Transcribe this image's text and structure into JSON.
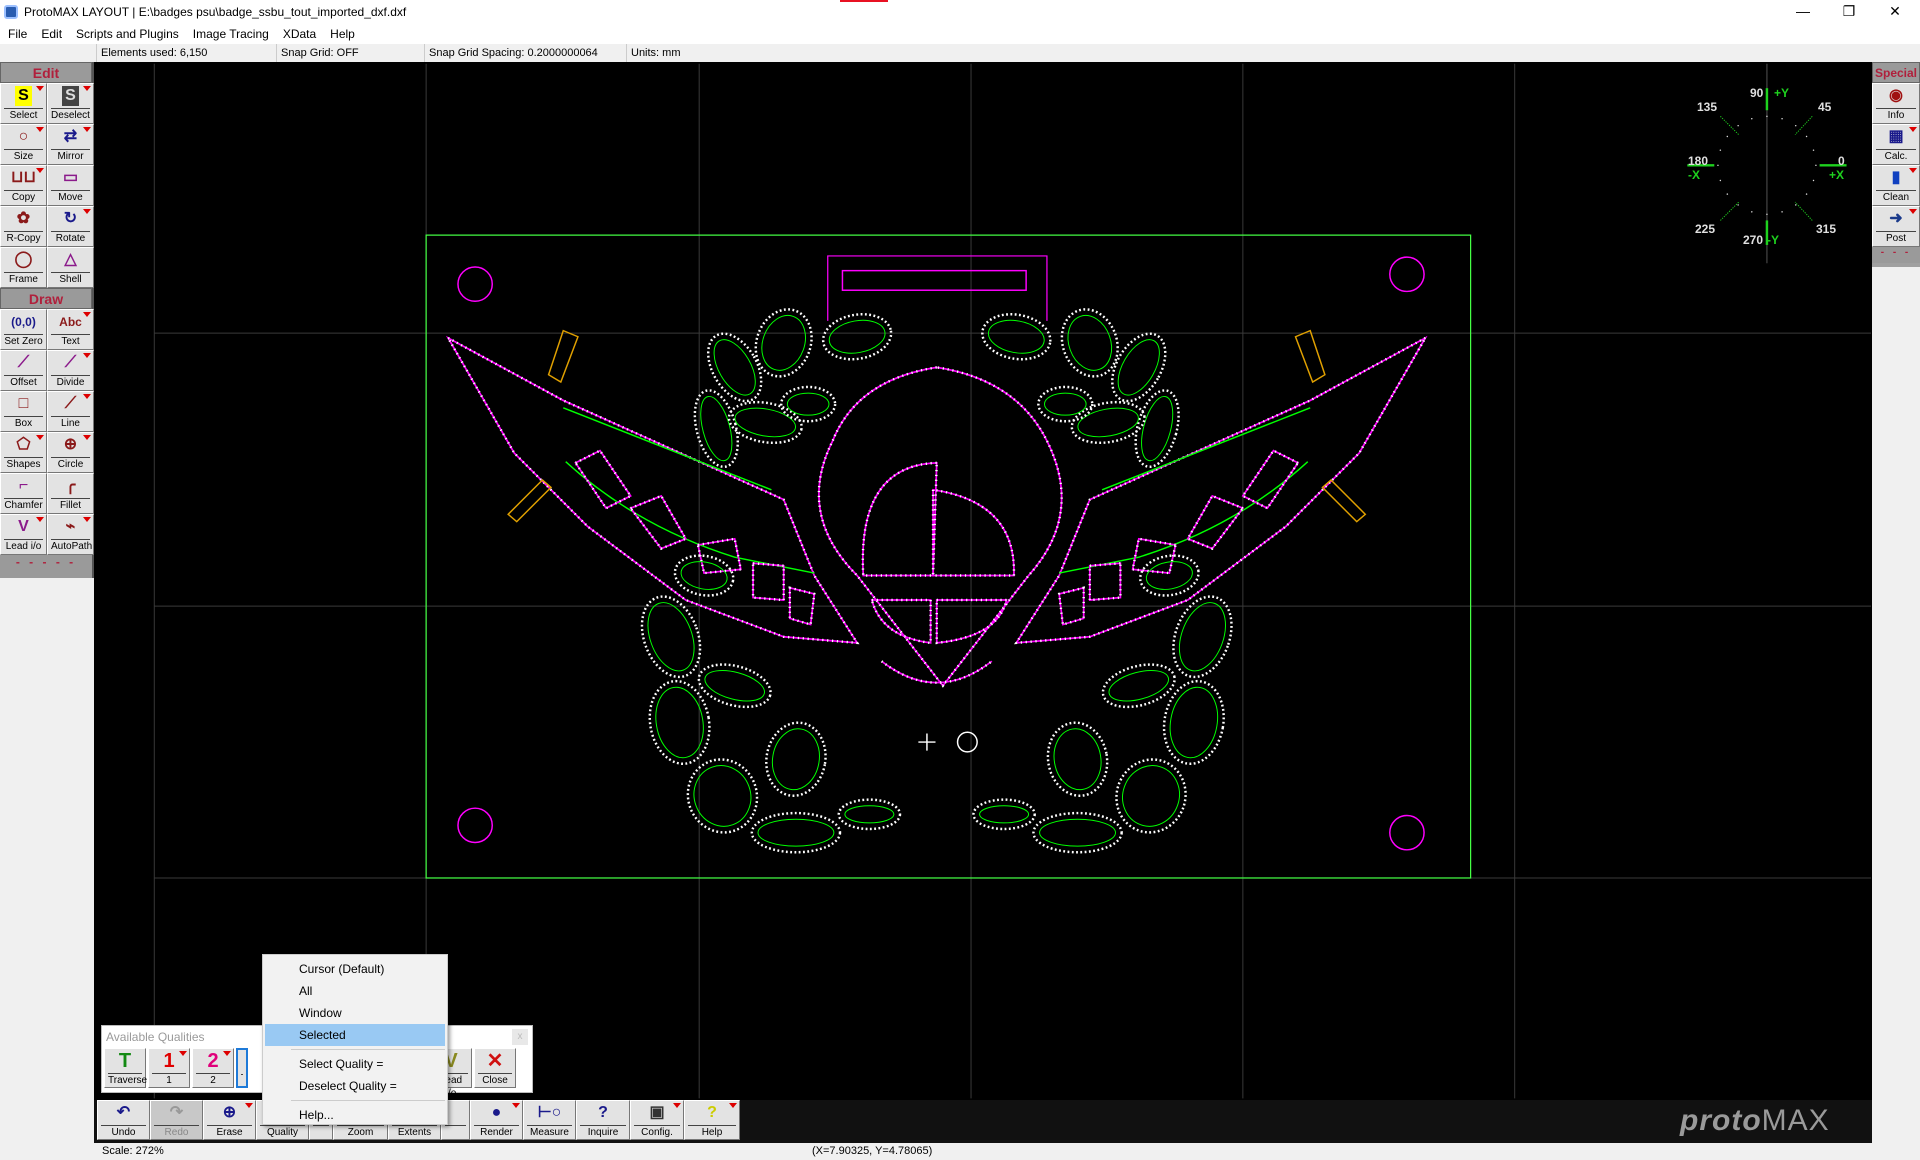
{
  "window": {
    "title": "ProtoMAX LAYOUT | E:\\badges psu\\badge_ssbu_tout_imported_dxf.dxf",
    "minimize": "—",
    "restore": "❐",
    "close": "✕"
  },
  "menu": [
    "File",
    "Edit",
    "Scripts and Plugins",
    "Image Tracing",
    "XData",
    "Help"
  ],
  "info": {
    "elements": "Elements used: 6,150",
    "snap": "Snap Grid: OFF",
    "spacing": "Snap Grid Spacing: 0.2000000064",
    "units": "Units: mm"
  },
  "left_toolbar": {
    "edit_header": "Edit",
    "draw_header": "Draw",
    "footer": "- - - - -",
    "edit": [
      {
        "label": "Select",
        "icon": "select-icon"
      },
      {
        "label": "Deselect",
        "icon": "deselect-icon"
      },
      {
        "label": "Size",
        "icon": "size-icon"
      },
      {
        "label": "Mirror",
        "icon": "mirror-icon"
      },
      {
        "label": "Copy",
        "icon": "copy-icon"
      },
      {
        "label": "Move",
        "icon": "move-icon"
      },
      {
        "label": "R-Copy",
        "icon": "rotary-copy-icon"
      },
      {
        "label": "Rotate",
        "icon": "rotate-icon"
      },
      {
        "label": "Frame",
        "icon": "frame-icon"
      },
      {
        "label": "Shell",
        "icon": "shell-icon"
      }
    ],
    "draw": [
      {
        "label": "Set Zero",
        "icon": "set-zero-icon",
        "glyph": "(0,0)"
      },
      {
        "label": "Text",
        "icon": "text-icon",
        "glyph": "Abc"
      },
      {
        "label": "Offset",
        "icon": "offset-icon"
      },
      {
        "label": "Divide",
        "icon": "divide-icon"
      },
      {
        "label": "Box",
        "icon": "box-icon"
      },
      {
        "label": "Line",
        "icon": "line-icon"
      },
      {
        "label": "Shapes",
        "icon": "shapes-icon"
      },
      {
        "label": "Circle",
        "icon": "circle-icon"
      },
      {
        "label": "Chamfer",
        "icon": "chamfer-icon"
      },
      {
        "label": "Fillet",
        "icon": "fillet-icon"
      },
      {
        "label": "Lead i/o",
        "icon": "lead-io-icon"
      },
      {
        "label": "AutoPath",
        "icon": "autopath-icon"
      }
    ]
  },
  "right_toolbar": {
    "header": "Special",
    "footer": "- - -",
    "items": [
      {
        "label": "Info",
        "icon": "info-icon"
      },
      {
        "label": "Calc.",
        "icon": "calculator-icon"
      },
      {
        "label": "Clean",
        "icon": "clean-icon"
      },
      {
        "label": "Post",
        "icon": "post-arrow-icon"
      }
    ]
  },
  "compass": {
    "a0": "0",
    "a45": "45",
    "a90": "90",
    "a135": "135",
    "a180": "180",
    "a225": "225",
    "a270": "270",
    "a315": "315",
    "px": "+X",
    "nx": "-X",
    "py": "+Y",
    "ny": "-Y"
  },
  "colors": {
    "cut_outer": "#ff00ff",
    "cut_inner": "#00ff00",
    "border": "#44ff44",
    "lead": "#e0a000",
    "highlight": "#99c9f3"
  },
  "qualities": {
    "title": "Available Qualities",
    "close": "x",
    "buttons": [
      {
        "label": "Traverse",
        "glyph": "T"
      },
      {
        "label": "1",
        "glyph": "1"
      },
      {
        "label": "2",
        "glyph": "2"
      },
      {
        "label": "",
        "glyph": ""
      },
      {
        "label": "Lead i/o",
        "glyph": "V"
      },
      {
        "label": "Close",
        "glyph": "✕"
      }
    ]
  },
  "popup": {
    "items": [
      "Cursor (Default)",
      "All",
      "Window",
      "Selected",
      "Select Quality =",
      "Deselect Quality =",
      "Help..."
    ],
    "selected": "Selected"
  },
  "bottom_toolbar": [
    {
      "label": "Undo",
      "glyph": "↶"
    },
    {
      "label": "Redo",
      "glyph": "↷"
    },
    {
      "label": "Erase",
      "glyph": "⊕"
    },
    {
      "label": "Quality",
      "glyph": "◯"
    },
    {
      "label": "",
      "glyph": ""
    },
    {
      "label": "Zoom",
      "glyph": ""
    },
    {
      "label": "Extents",
      "glyph": ""
    },
    {
      "label": "",
      "glyph": ""
    },
    {
      "label": "Render",
      "glyph": "●"
    },
    {
      "label": "Measure",
      "glyph": "⊢○"
    },
    {
      "label": "Inquire",
      "glyph": "?"
    },
    {
      "label": "Config.",
      "glyph": "▣"
    },
    {
      "label": "Help",
      "glyph": "?"
    }
  ],
  "status": {
    "scale": "Scale: 272%",
    "coords": "(X=7.90325, Y=4.78065)"
  },
  "logo": {
    "text_a": "proto",
    "text_b": "MAX"
  }
}
